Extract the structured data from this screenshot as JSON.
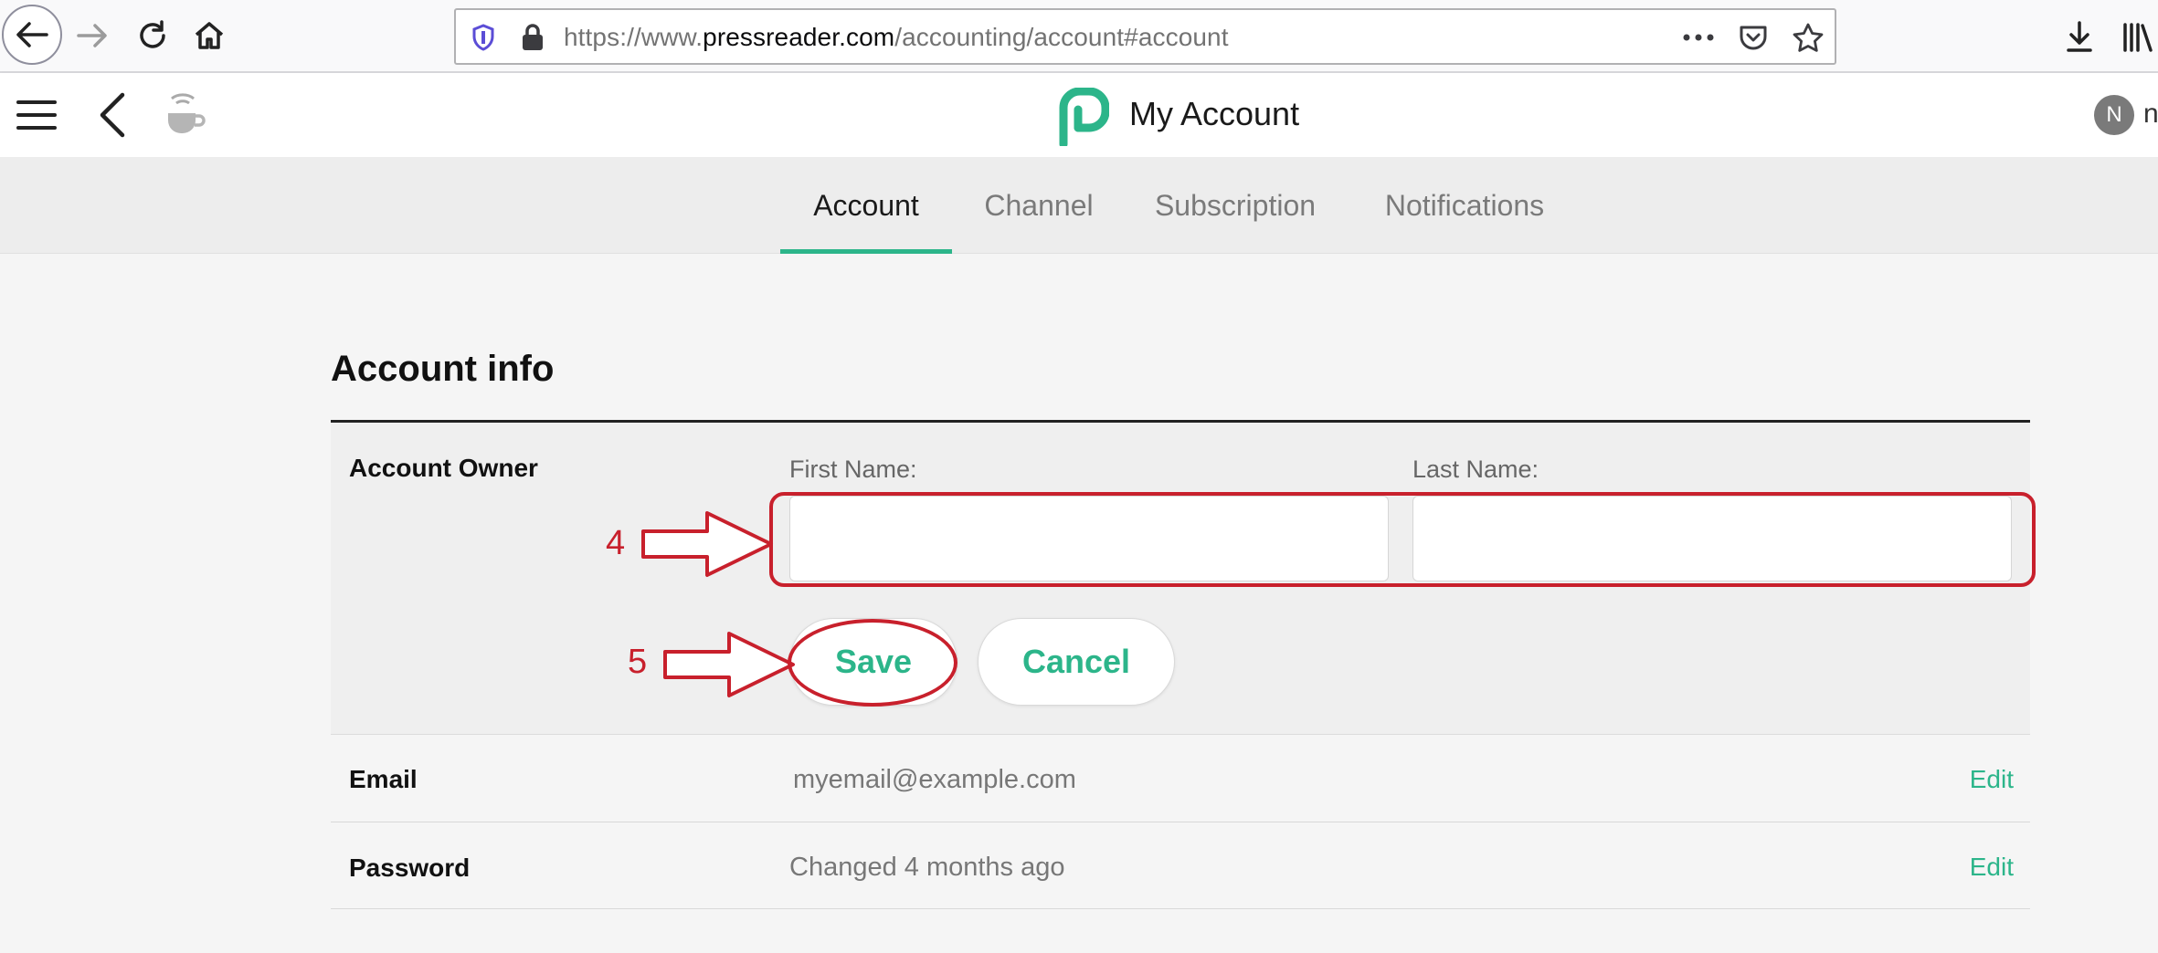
{
  "browser": {
    "url_prefix": "https://www.",
    "url_host": "pressreader.com",
    "url_path": "/accounting/account#account"
  },
  "header": {
    "title": "My Account",
    "avatar_initial": "N",
    "avatar_name": "n"
  },
  "tabs": [
    {
      "label": "Account",
      "active": true
    },
    {
      "label": "Channel",
      "active": false
    },
    {
      "label": "Subscription",
      "active": false
    },
    {
      "label": "Notifications",
      "active": false
    }
  ],
  "account_info": {
    "title": "Account info",
    "owner": {
      "label": "Account Owner",
      "first_name_label": "First Name:",
      "last_name_label": "Last Name:",
      "first_name_value": "",
      "last_name_value": ""
    },
    "save_label": "Save",
    "cancel_label": "Cancel",
    "email": {
      "label": "Email",
      "value": "myemail@example.com",
      "action": "Edit"
    },
    "password": {
      "label": "Password",
      "value": "Changed 4 months ago",
      "action": "Edit"
    }
  },
  "annotations": {
    "step_inputs": "4",
    "step_save": "5",
    "color": "#c8202c"
  },
  "colors": {
    "accent": "#2cb58a"
  }
}
